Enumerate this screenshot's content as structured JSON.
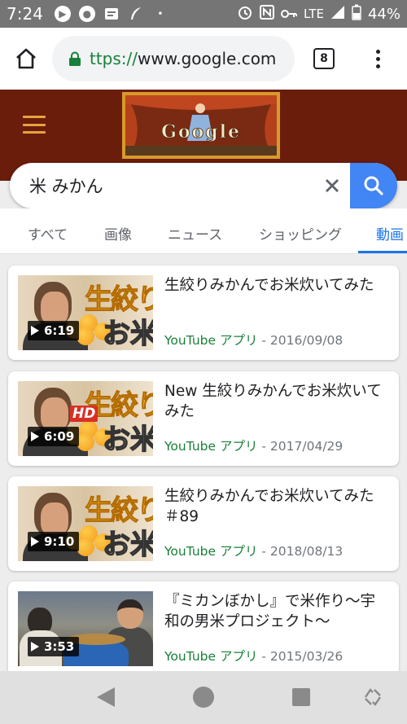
{
  "status_bar": {
    "time": "7:24",
    "network": "LTE",
    "battery": "44%"
  },
  "browser": {
    "url_scheme": "ttps://",
    "url_host": "www.google.com",
    "tab_count": "8"
  },
  "doodle": {
    "logo_text": "Google"
  },
  "search": {
    "query": "米 みかん",
    "accent": "#4285f4"
  },
  "tabs": [
    {
      "label": "すべて",
      "active": false
    },
    {
      "label": "画像",
      "active": false
    },
    {
      "label": "ニュース",
      "active": false
    },
    {
      "label": "ショッピング",
      "active": false
    },
    {
      "label": "動画",
      "active": true
    }
  ],
  "results": [
    {
      "title": "生絞りみかんでお米炊いてみた",
      "source": "YouTube アプリ",
      "date": "- 2016/09/08",
      "duration": "6:19",
      "thumb_text_1": "生絞り",
      "thumb_text_2": "お米",
      "thumb_badge": ""
    },
    {
      "title": "New 生絞りみかんでお米炊いてみた",
      "source": "YouTube アプリ",
      "date": "- 2017/04/29",
      "duration": "6:09",
      "thumb_text_1": "生絞り",
      "thumb_text_2": "お米",
      "thumb_badge": "HD"
    },
    {
      "title": "生絞りみかんでお米炊いてみた＃89",
      "source": "YouTube アプリ",
      "date": "- 2018/08/13",
      "duration": "9:10",
      "thumb_text_1": "生絞り",
      "thumb_text_2": "お米",
      "thumb_badge": ""
    },
    {
      "title": "『ミカンぼかし』で米作り〜宇和の男米プロジェクト〜",
      "source": "YouTube アプリ",
      "date": "- 2015/03/26",
      "duration": "3:53"
    }
  ],
  "colors": {
    "status_bar": "#757575",
    "header_background": "#6b1d0c",
    "link_green": "#188038",
    "active_tab": "#1a73e8"
  }
}
